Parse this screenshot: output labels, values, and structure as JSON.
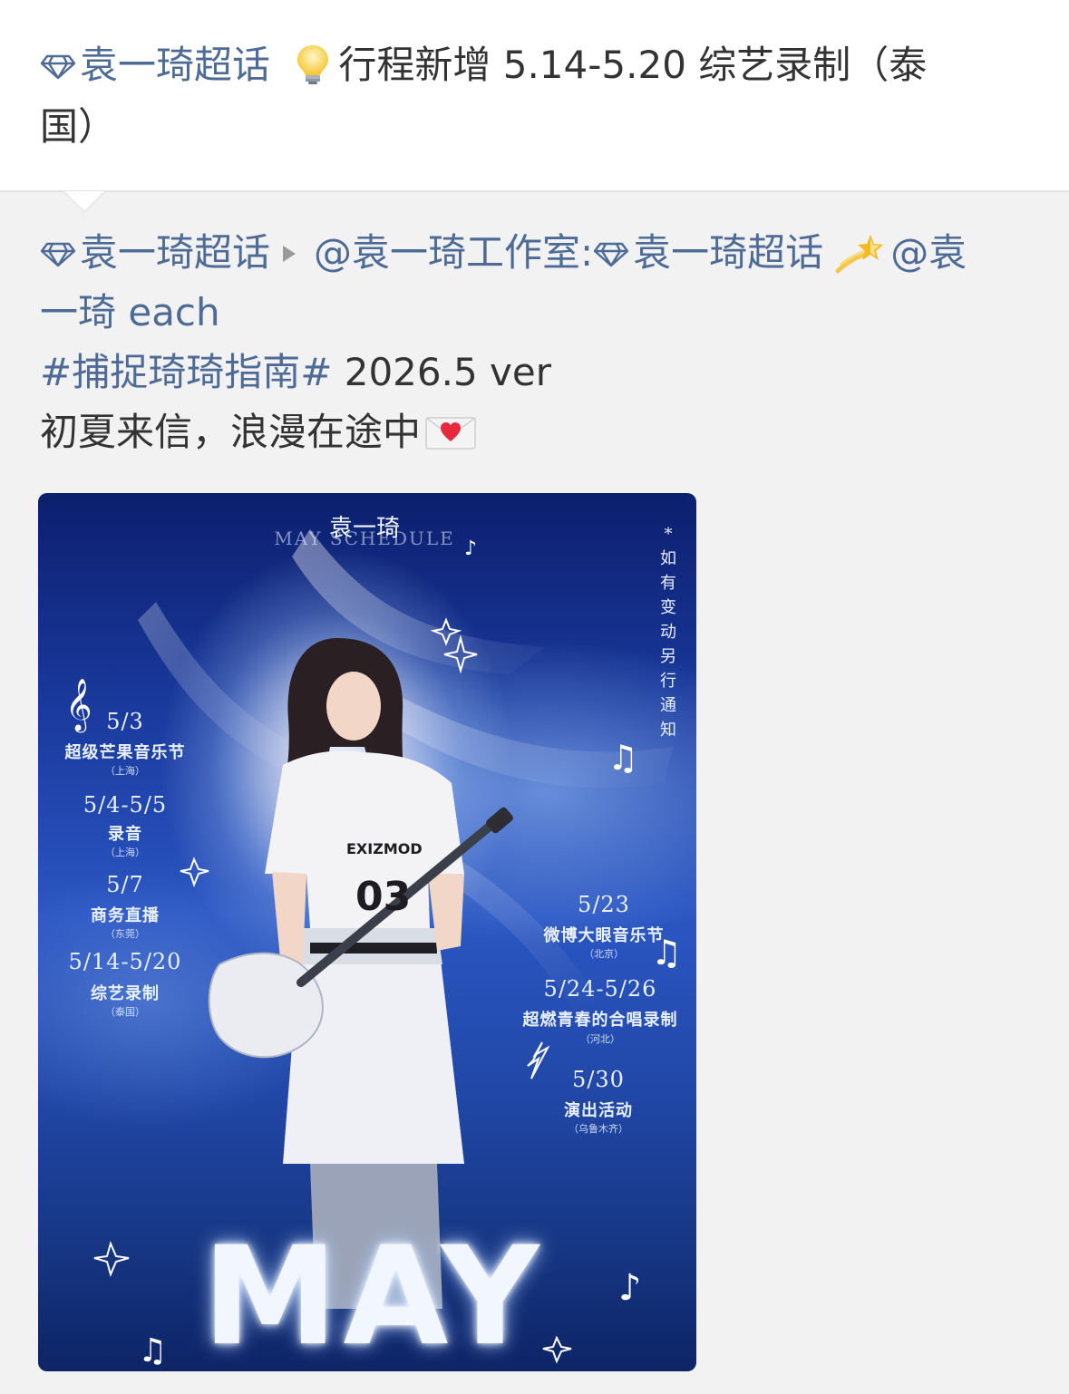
{
  "post": {
    "topic": "袁一琦超话",
    "text_line1": "行程新增 5.14-5.20 综艺录制（泰",
    "text_line2": "国）",
    "icons": {
      "gem": "diamond-topic-icon",
      "bulb": "lightbulb-emoji"
    }
  },
  "repost": {
    "topic": "袁一琦超话",
    "mention_studio": "@袁一琦工作室:",
    "topic2": "袁一琦超话",
    "mention_each_part1": "@袁",
    "mention_each_part2": "一琦 each",
    "hashtag": "#捕捉琦琦指南#",
    "version": " 2026.5 ver",
    "line4": "初夏来信，浪漫在途中",
    "icons": {
      "dizzy": "dizzy-emoji",
      "envelope": "love-letter-emoji"
    }
  },
  "poster": {
    "name": "袁一琦",
    "subtitle": "MAY SCHEDULE",
    "notice": "*如有变动 另行通知",
    "big_title": "MAY",
    "left_events": [
      {
        "date": "5/3",
        "event": "超级芒果音乐节",
        "place": "（上海）"
      },
      {
        "date": "5/4-5/5",
        "event": "录音",
        "place": "（上海）"
      },
      {
        "date": "5/7",
        "event": "商务直播",
        "place": "（东莞）"
      },
      {
        "date": "5/14-5/20",
        "event": "综艺录制",
        "place": "（泰国）"
      }
    ],
    "right_events": [
      {
        "date": "5/23",
        "event": "微博大眼音乐节",
        "place": "（北京）"
      },
      {
        "date": "5/24-5/26",
        "event": "超燃青春的合唱录制",
        "place": "（河北）"
      },
      {
        "date": "5/30",
        "event": "演出活动",
        "place": "（乌鲁木齐）"
      }
    ],
    "shirt_text": "EXIZMOD",
    "shirt_number": "03"
  },
  "colors": {
    "link": "#4d6b96",
    "text": "#333333",
    "background": "#f2f2f2",
    "poster_blue": "#2b56c2"
  }
}
